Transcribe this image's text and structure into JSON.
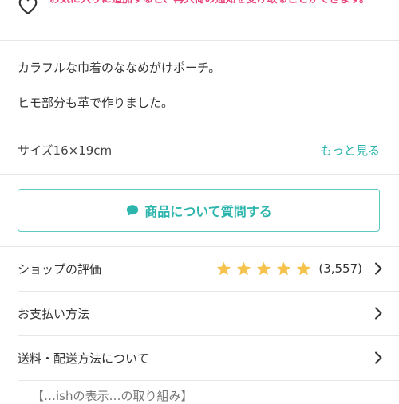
{
  "favorite_banner": {
    "message": "お気に入りに追加すると、再入荷の通知を受け取ることができます。",
    "icon": "heart-outline-icon"
  },
  "description": {
    "lines": [
      "カラフルな巾着のななめがけポーチ。",
      "ヒモ部分も革で作りました。"
    ]
  },
  "size": {
    "text": "サイズ16×19cm",
    "more_label": "もっと見る"
  },
  "ask_button": {
    "label": "商品について質問する",
    "icon": "speech-bubble-icon"
  },
  "menu": {
    "shop_rating": {
      "label": "ショップの評価",
      "stars": 5,
      "count": "(3,557)"
    },
    "payment": {
      "label": "お支払い方法"
    },
    "shipping": {
      "label": "送料・配送方法について"
    }
  },
  "footer_partial": {
    "text": "【…ishの表示…の取り組み】"
  },
  "colors": {
    "accent": "#2bb5ad",
    "favorite": "#e8467c",
    "star": "#f5c24c"
  }
}
